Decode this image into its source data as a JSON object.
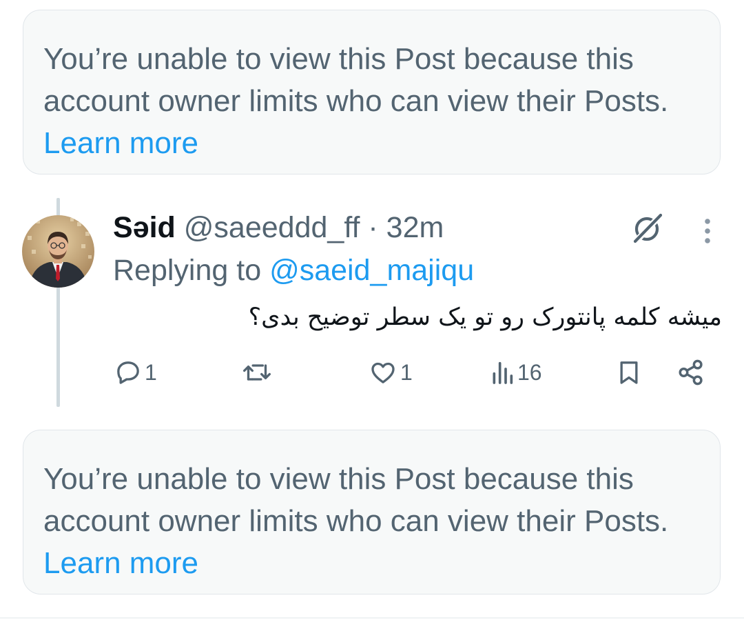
{
  "notice_top": {
    "text": "You’re unable to view this Post because this account owner limits who can view their Posts. ",
    "link_label": "Learn more"
  },
  "post": {
    "display_name": "Səid",
    "handle": "@saeeddd_ff",
    "separator": " · ",
    "time": "32m",
    "replying_label": "Replying to ",
    "replying_handle": "@saeid_majiqu",
    "text": "میشه کلمه پانتورک رو تو یک سطر توضیح بدی؟",
    "avatar_icon": "user-avatar-photo",
    "actions": {
      "reply_count": "1",
      "repost_count": "",
      "like_count": "1",
      "views_count": "16"
    },
    "icons": {
      "grok": "grok-icon",
      "more": "more-options-icon",
      "reply": "comment-icon",
      "repost": "repost-icon",
      "like": "heart-icon",
      "views": "analytics-icon",
      "bookmark": "bookmark-icon",
      "share": "share-icon"
    }
  },
  "notice_bottom": {
    "text": "You’re unable to view this Post because this account owner limits who can view their Posts. ",
    "link_label": "Learn more"
  },
  "colors": {
    "link": "#1d9bf0",
    "secondary_text": "#536471",
    "primary_text": "#0f1419",
    "notice_bg": "#f7f9f9",
    "notice_border": "#e1e6ea",
    "thread_line": "#cfd9de"
  }
}
